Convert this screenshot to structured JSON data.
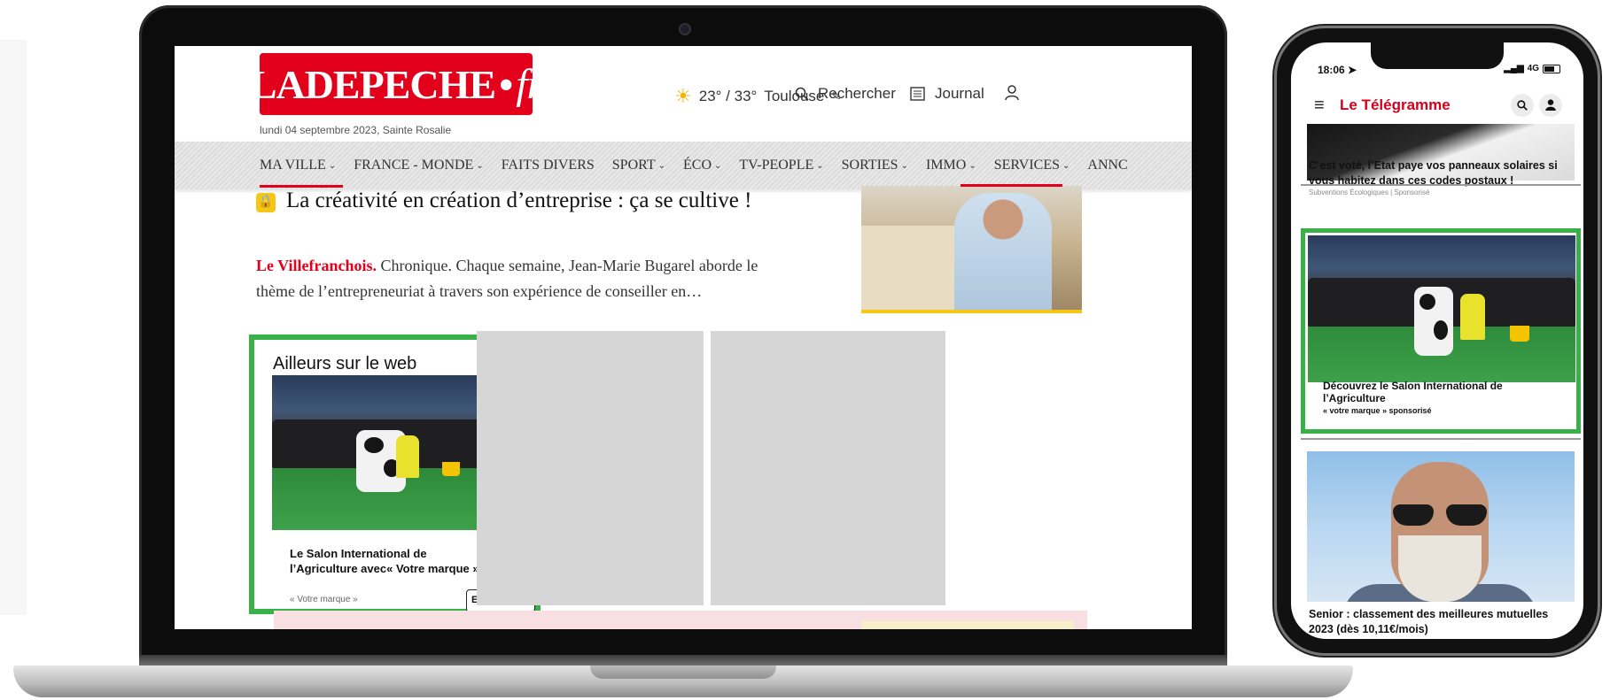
{
  "laptop": {
    "header": {
      "logo_main": "LADEPECHE",
      "logo_dot": "•",
      "logo_suffix": "fr",
      "date": "lundi 04 septembre 2023, Sainte Rosalie",
      "weather": {
        "temps": "23° / 33°",
        "city": "Toulouse"
      },
      "search_label": "Rechercher",
      "journal_label": "Journal"
    },
    "nav": {
      "items": [
        {
          "label": "MA VILLE",
          "chevron": true
        },
        {
          "label": "FRANCE - MONDE",
          "chevron": true
        },
        {
          "label": "FAITS DIVERS",
          "chevron": false
        },
        {
          "label": "SPORT",
          "chevron": true
        },
        {
          "label": "ÉCO",
          "chevron": true
        },
        {
          "label": "TV-PEOPLE",
          "chevron": true
        },
        {
          "label": "SORTIES",
          "chevron": true
        },
        {
          "label": "IMMO",
          "chevron": true
        },
        {
          "label": "SERVICES",
          "chevron": true
        },
        {
          "label": "ANNC",
          "chevron": false
        }
      ]
    },
    "article": {
      "title": "La créativité en création d’entreprise : ça se cultive !",
      "source": "Le Villefranchois.",
      "excerpt": " Chronique. Chaque semaine, Jean-Marie Bugarel aborde le thème de l’entrepreneuriat à travers son expérience de conseiller en…"
    },
    "ad": {
      "heading": "Ailleurs sur le web",
      "title_line1": "Le Salon International de",
      "title_line2": "l’Agriculture avec« Votre marque »",
      "brand": "« Votre marque »",
      "cta": "En savoir plus"
    }
  },
  "phone": {
    "status": {
      "time": "18:06",
      "network": "4G"
    },
    "app_name": "Le Télégramme",
    "article1": {
      "text": "C’est voté, l’Etat paye vos panneaux solaires si vous habitez dans ces codes postaux !",
      "sub": "Subventions Écologiques | Sponsorisé"
    },
    "ad": {
      "title": "Découvrez le Salon International de l’Agriculture",
      "brand": "« votre marque » sponsorisé"
    },
    "article2": {
      "text": "Senior : classement des meilleures mutuelles 2023 (dès 10,11€/mois)"
    }
  },
  "colors": {
    "brand_red": "#e2001a",
    "ad_border_green": "#38b248",
    "tele_red": "#d4001c",
    "lock_yellow": "#f5c518"
  },
  "icons": [
    "sun-icon",
    "pencil-icon",
    "search-icon",
    "newspaper-icon",
    "user-icon",
    "lock-icon",
    "chevron-down-icon",
    "menu-icon",
    "location-arrow-icon",
    "battery-icon"
  ]
}
